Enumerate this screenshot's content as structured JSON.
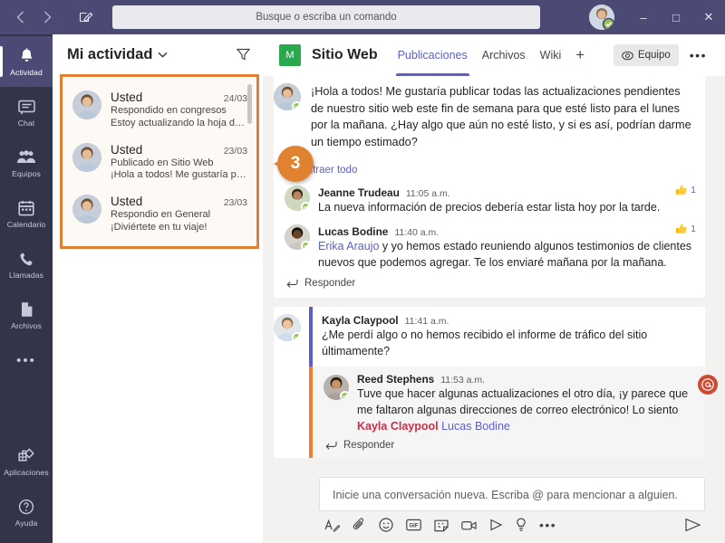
{
  "titlebar": {
    "back_icon": "chevron-left-icon",
    "forward_icon": "chevron-right-icon",
    "compose_icon": "compose-icon",
    "search_placeholder": "Busque o escriba un comando",
    "minimize_label": "–",
    "maximize_label": "□",
    "close_label": "✕"
  },
  "rail": {
    "items": [
      {
        "label": "Actividad",
        "icon": "bell-icon",
        "active": true
      },
      {
        "label": "Chat",
        "icon": "chat-icon",
        "active": false
      },
      {
        "label": "Equipos",
        "icon": "teams-icon",
        "active": false
      },
      {
        "label": "Calendario",
        "icon": "calendar-icon",
        "active": false
      },
      {
        "label": "Llamadas",
        "icon": "phone-icon",
        "active": false
      },
      {
        "label": "Archivos",
        "icon": "files-icon",
        "active": false
      }
    ],
    "more_label": "•••",
    "bottom": [
      {
        "label": "Aplicaciones",
        "icon": "apps-icon"
      },
      {
        "label": "Ayuda",
        "icon": "help-icon"
      }
    ]
  },
  "activity": {
    "title": "Mi actividad",
    "chevron_icon": "chevron-down-icon",
    "filter_icon": "filter-icon",
    "items": [
      {
        "name": "Usted",
        "date": "24/03",
        "subtitle": "Respondido en congresos",
        "preview": "Estoy actualizando la hoja de..."
      },
      {
        "name": "Usted",
        "date": "23/03",
        "subtitle": "Publicado en Sitio Web",
        "preview": "¡Hola a todos! Me gustaría publicar..."
      },
      {
        "name": "Usted",
        "date": "23/03",
        "subtitle": "Respondio en General",
        "preview": "¡Diviértete en tu viaje!"
      }
    ]
  },
  "callout": {
    "number": "3",
    "color": "#e0822f"
  },
  "channel": {
    "team_initial": "M",
    "team_name": "Sitio Web",
    "tabs": [
      {
        "label": "Publicaciones",
        "active": true
      },
      {
        "label": "Archivos",
        "active": false
      },
      {
        "label": "Wiki",
        "active": false
      }
    ],
    "add_tab_label": "+",
    "team_button": "Equipo",
    "team_button_icon": "eye-icon",
    "more_label": "•••"
  },
  "thread": {
    "root_message": "¡Hola a todos! Me gustaría publicar todas las actualizaciones pendientes  de nuestro sitio web este fin de semana para que esté listo para el lunes por la mañana. ¿Hay algo que aún no esté listo, y si es así, podrían darme un tiempo estimado?",
    "collapse_label": "Contraer todo",
    "collapse_icon": "chevron-down-small-icon",
    "replies": [
      {
        "name": "Jeanne Trudeau",
        "time": "11:05 a.m.",
        "text": "La nueva información de precios debería estar lista hoy por la tarde.",
        "reaction_icon": "thumbs-up-icon",
        "reaction_count": "1"
      },
      {
        "name": "Lucas Bodine",
        "time": "11:40 a.m.",
        "mention": "Erika Araujo",
        "text": " y yo hemos estado reuniendo algunos testimonios de clientes nuevos que podemos agregar. Te los enviaré mañana por la mañana.",
        "reaction_icon": "thumbs-up-icon",
        "reaction_count": "1"
      }
    ],
    "reply_label": "Responder",
    "reply_icon": "reply-arrow-icon",
    "second_post": {
      "name": "Kayla Claypool",
      "time": "11:41 a.m.",
      "text": "¿Me perdí algo o no hemos recibido el informe de tráfico del sitio últimamente?",
      "nested": {
        "name": "Reed Stephens",
        "time": "11:53 a.m.",
        "text_part1": "Tuve que hacer algunas actualizaciones el otro día, ¡y parece que me faltaron algunas direcciones de correo electrónico! Lo siento ",
        "mention_me": "Kayla Claypool",
        "mention_other": "Lucas Bodine",
        "at_badge_icon": "at-mention-icon"
      },
      "reply_label": "Responder",
      "reply_icon": "reply-arrow-icon"
    }
  },
  "compose": {
    "placeholder": "Inicie una conversación nueva. Escriba @ para mencionar a alguien.",
    "tools": [
      {
        "name": "format-icon"
      },
      {
        "name": "attach-icon"
      },
      {
        "name": "emoji-icon"
      },
      {
        "name": "gif-icon"
      },
      {
        "name": "sticker-icon"
      },
      {
        "name": "meet-now-icon"
      },
      {
        "name": "stream-icon"
      },
      {
        "name": "praise-icon"
      }
    ],
    "more_label": "•••",
    "send_icon": "send-icon"
  }
}
